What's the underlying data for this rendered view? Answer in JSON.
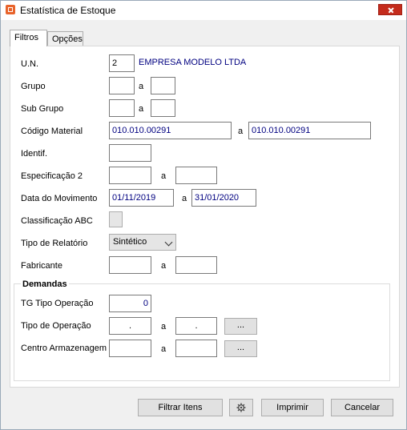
{
  "window": {
    "title": "Estatística de Estoque"
  },
  "tabs": [
    {
      "label": "Filtros"
    },
    {
      "label": "Opções"
    }
  ],
  "fields": {
    "un": {
      "label": "U.N.",
      "value": "2",
      "company": "EMPRESA MODELO LTDA"
    },
    "grupo": {
      "label": "Grupo",
      "from": "",
      "sep": "a",
      "to": ""
    },
    "sub_grupo": {
      "label": "Sub Grupo",
      "from": "",
      "sep": "a",
      "to": ""
    },
    "codigo_material": {
      "label": "Código Material",
      "from": "010.010.00291",
      "sep": "a",
      "to": "010.010.00291"
    },
    "identif": {
      "label": "Identif.",
      "value": ""
    },
    "especificacao2": {
      "label": "Especificação 2",
      "from": "",
      "sep": "a",
      "to": ""
    },
    "data_movimento": {
      "label": "Data do Movimento",
      "from": "01/11/2019",
      "sep": "a",
      "to": "31/01/2020"
    },
    "classificacao_abc": {
      "label": "Classificação ABC",
      "checked": false
    },
    "tipo_relatorio": {
      "label": "Tipo de Relatório",
      "value": "Sintético"
    },
    "fabricante": {
      "label": "Fabricante",
      "from": "",
      "sep": "a",
      "to": ""
    }
  },
  "demandas": {
    "title": "Demandas",
    "tg_tipo_operacao": {
      "label": "TG Tipo Operação",
      "value": "0"
    },
    "tipo_operacao": {
      "label": "Tipo de Operação",
      "from": ".",
      "sep": "a",
      "to": ".",
      "browse": "..."
    },
    "centro_armazenagem": {
      "label": "Centro Armazenagem",
      "from": "",
      "sep": "a",
      "to": "",
      "browse": "..."
    }
  },
  "buttons": {
    "filtrar": "Filtrar Itens",
    "settings_icon": "gear-icon",
    "imprimir": "Imprimir",
    "cancelar": "Cancelar"
  }
}
